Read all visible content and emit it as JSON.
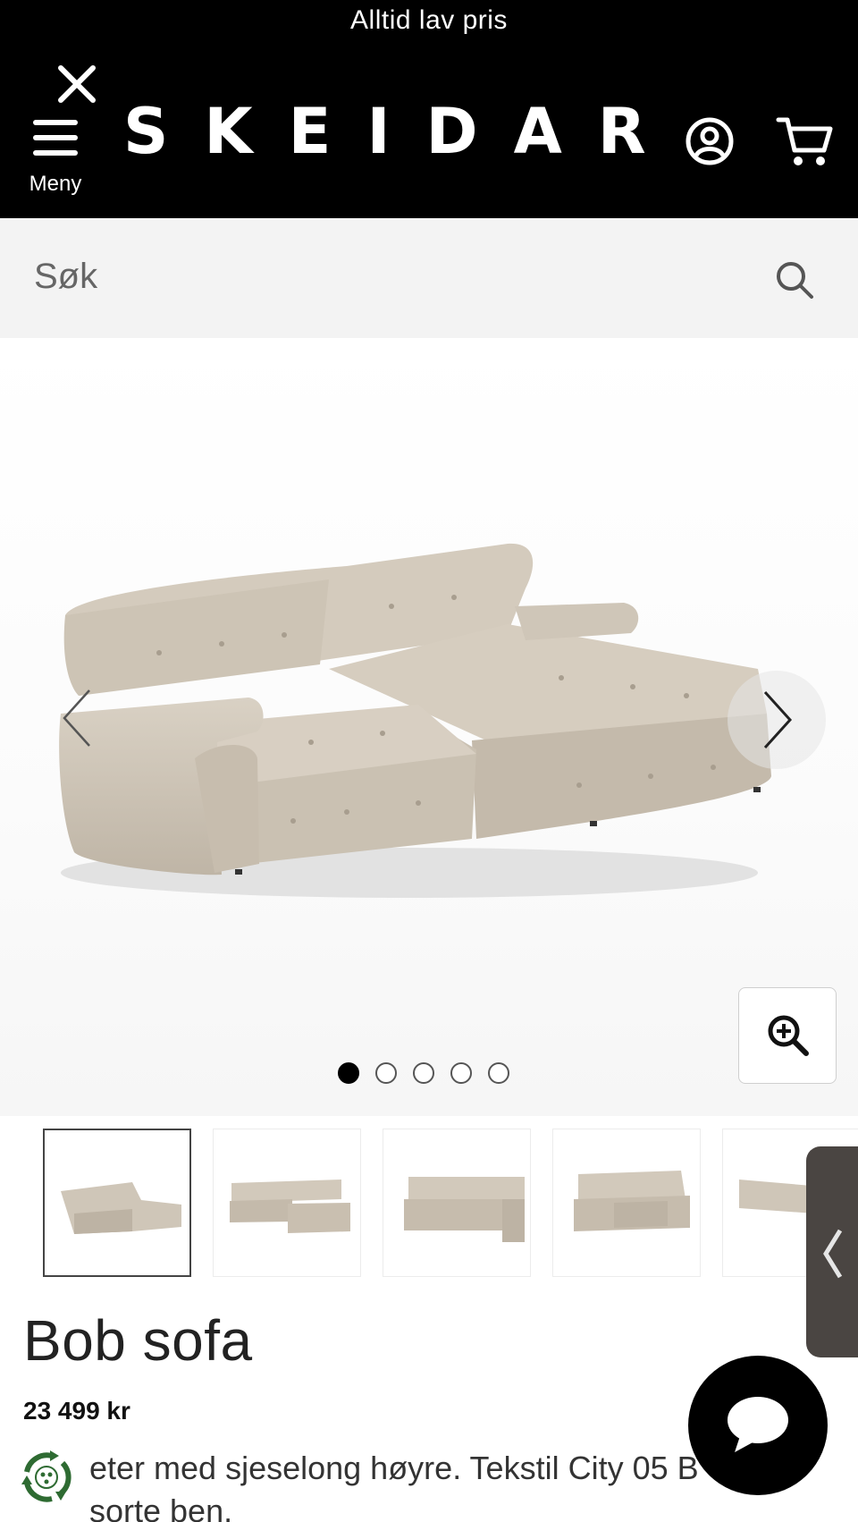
{
  "header": {
    "banner_text": "Alltid lav pris",
    "menu_label": "Meny",
    "logo_text": "SKEIDAR",
    "icons": {
      "close": "close-icon",
      "menu": "hamburger-menu-icon",
      "account": "account-icon",
      "cart": "cart-icon"
    }
  },
  "search": {
    "placeholder": "Søk",
    "icon": "search-icon"
  },
  "gallery": {
    "slide_count": 5,
    "active_slide": 1,
    "prev_icon": "chevron-left-icon",
    "next_icon": "chevron-right-icon",
    "zoom_icon": "zoom-in-icon",
    "thumbnail_count": 5,
    "selected_thumbnail": 1
  },
  "product": {
    "title": "Bob sofa",
    "price": "23 499 kr",
    "description_line1": "eter med sjeselong høyre. Tekstil City 05 B",
    "description_line2": "sorte ben."
  },
  "widgets": {
    "chat_icon": "chat-bubble-icon",
    "drawer_icon": "chevron-left-icon",
    "eco_icon": "eco-recycle-badge-icon"
  },
  "colors": {
    "header_bg": "#000000",
    "search_bg": "#f3f3f3",
    "sofa": "#cfc6b8",
    "drawer_tab": "#4a4542"
  }
}
